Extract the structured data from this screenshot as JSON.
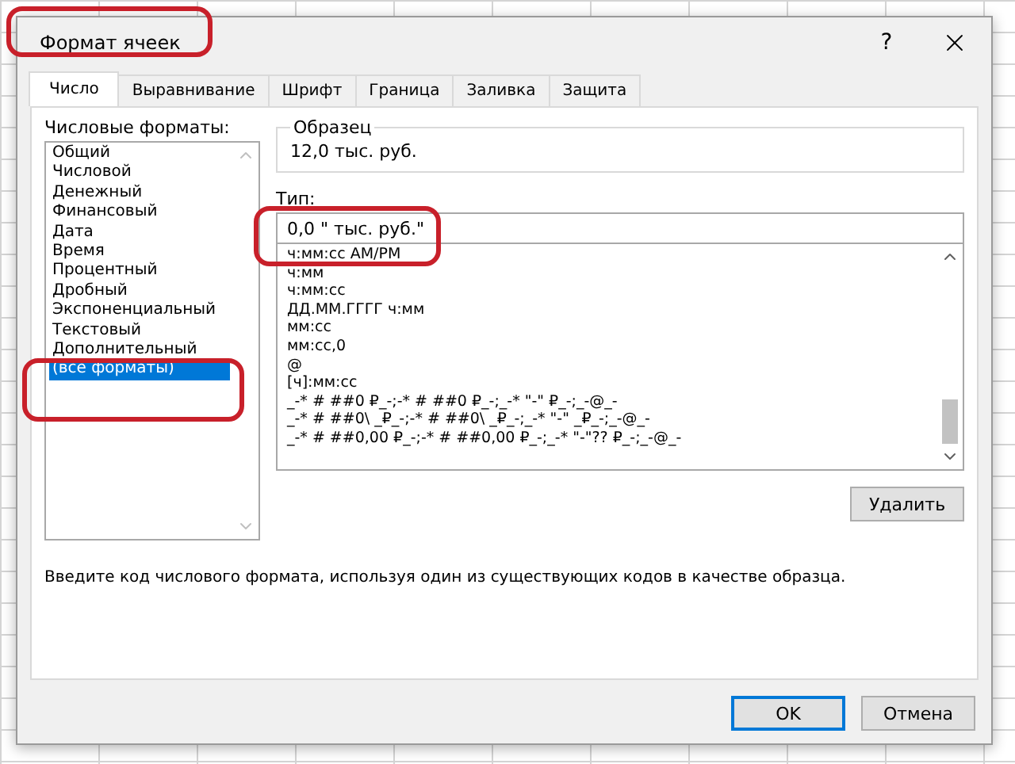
{
  "window": {
    "title": "Формат ячеек",
    "help": "?"
  },
  "tabs": [
    {
      "label": "Число",
      "selected": true
    },
    {
      "label": "Выравнивание",
      "selected": false
    },
    {
      "label": "Шрифт",
      "selected": false
    },
    {
      "label": "Граница",
      "selected": false
    },
    {
      "label": "Заливка",
      "selected": false
    },
    {
      "label": "Защита",
      "selected": false
    }
  ],
  "categories": {
    "label": "Числовые форматы:",
    "items": [
      {
        "label": "Общий",
        "selected": false
      },
      {
        "label": "Числовой",
        "selected": false
      },
      {
        "label": "Денежный",
        "selected": false
      },
      {
        "label": "Финансовый",
        "selected": false
      },
      {
        "label": "Дата",
        "selected": false
      },
      {
        "label": "Время",
        "selected": false
      },
      {
        "label": "Процентный",
        "selected": false
      },
      {
        "label": "Дробный",
        "selected": false
      },
      {
        "label": "Экспоненциальный",
        "selected": false
      },
      {
        "label": "Текстовый",
        "selected": false
      },
      {
        "label": "Дополнительный",
        "selected": false
      },
      {
        "label": "(все форматы)",
        "selected": true
      }
    ]
  },
  "sample": {
    "label": "Образец",
    "value": "12,0 тыс. руб."
  },
  "type": {
    "label": "Тип:",
    "value": "0,0 \" тыс. руб.\""
  },
  "formats": [
    "ч:мм:сс AM/PM",
    "ч:мм",
    "ч:мм:сс",
    "ДД.ММ.ГГГГ ч:мм",
    "мм:сс",
    "мм:сс,0",
    "@",
    "[ч]:мм:сс",
    "_-* # ##0 ₽_-;-* # ##0 ₽_-;_-* \"-\" ₽_-;_-@_-",
    "_-* # ##0\\ _₽_-;-* # ##0\\ _₽_-;_-* \"-\" _₽_-;_-@_-",
    "_-* # ##0,00 ₽_-;-* # ##0,00 ₽_-;_-* \"-\"?? ₽_-;_-@_-"
  ],
  "delete_button": "Удалить",
  "description": "Введите код числового формата, используя один из существующих кодов в качестве образца.",
  "buttons": [
    {
      "label": "OK",
      "default": true
    },
    {
      "label": "Отмена",
      "default": false
    }
  ]
}
